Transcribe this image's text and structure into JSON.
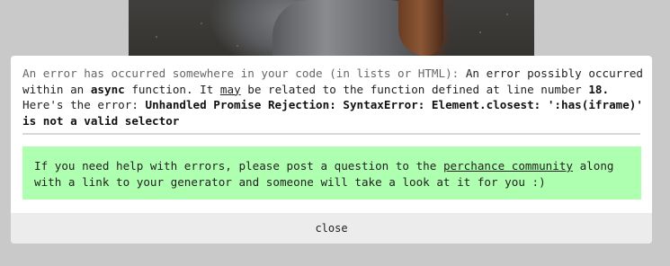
{
  "error": {
    "intro": "An error has occurred somewhere in your code (in lists or HTML): ",
    "part1": "An error possibly occurred within an ",
    "async_word": "async",
    "part2": " function. It ",
    "may_word": "may",
    "part3": " be related to the function defined at line number ",
    "line_number": "18.",
    "part4": " Here's the error: ",
    "error_text": "Unhandled Promise Rejection: SyntaxError: Element.closest: ':has(iframe)' is not a valid selector"
  },
  "help": {
    "part1": "If you need help with errors, please post a question to the ",
    "link_label": "perchance community",
    "part2": " along with a link to your generator and someone will take a look at it for you :)"
  },
  "close_label": "close"
}
